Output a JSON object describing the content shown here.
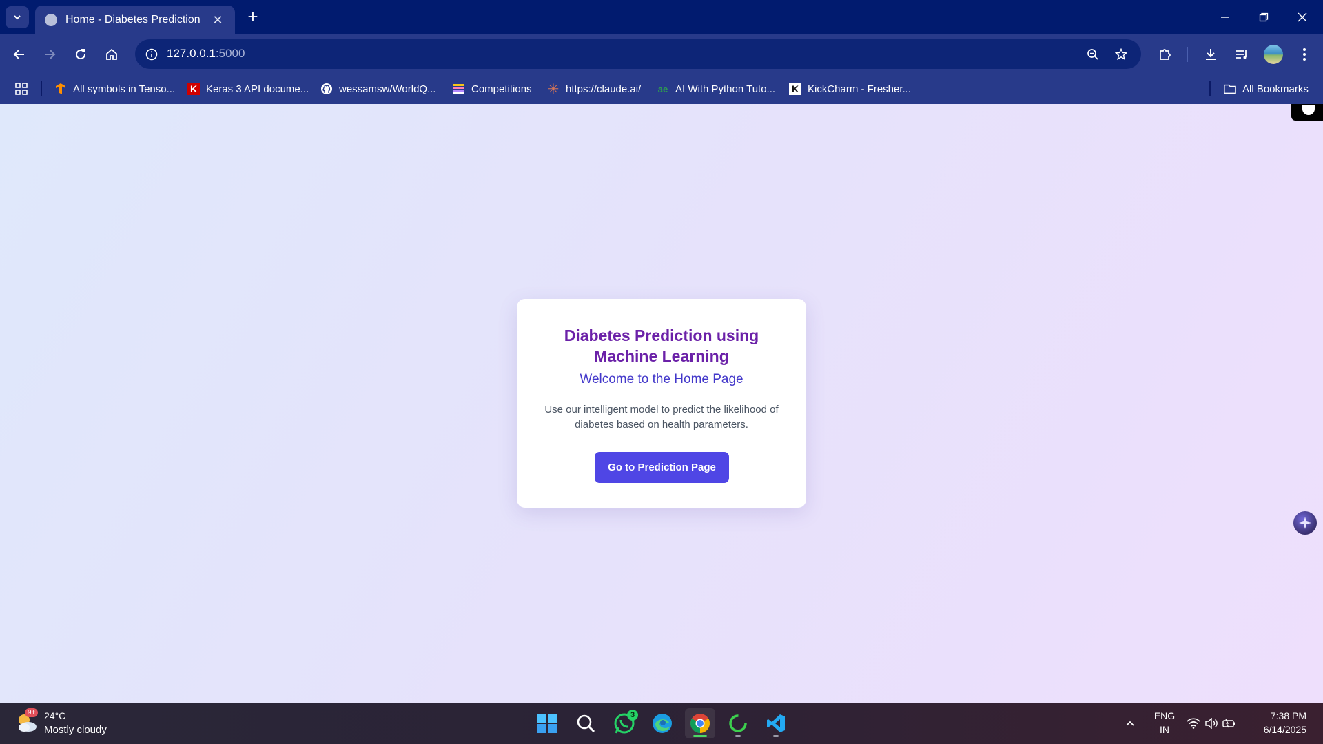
{
  "browser": {
    "tab_title": "Home - Diabetes Prediction",
    "new_tab_label": "+",
    "url_host": "127.0.0.1",
    "url_port": ":5000"
  },
  "bookmarks": [
    {
      "label": "All symbols in Tenso...",
      "icon": "tensorflow-icon"
    },
    {
      "label": "Keras 3 API docume...",
      "icon": "keras-icon"
    },
    {
      "label": "wessamsw/WorldQ...",
      "icon": "github-icon"
    },
    {
      "label": "Competitions",
      "icon": "competitions-icon"
    },
    {
      "label": "https://claude.ai/",
      "icon": "claude-icon"
    },
    {
      "label": "AI With Python Tuto...",
      "icon": "tutorial-icon"
    },
    {
      "label": "KickCharm - Fresher...",
      "icon": "kickcharm-icon"
    }
  ],
  "all_bookmarks_label": "All Bookmarks",
  "card": {
    "title": "Diabetes Prediction using Machine Learning",
    "subtitle": "Welcome to the Home Page",
    "description": "Use our intelligent model to predict the likelihood of diabetes based on health parameters.",
    "button_label": "Go to Prediction Page"
  },
  "taskbar": {
    "weather_temp": "24°C",
    "weather_desc": "Mostly cloudy",
    "weather_badge": "9+",
    "whatsapp_badge": "3",
    "language_line1": "ENG",
    "language_line2": "IN",
    "time": "7:38 PM",
    "date": "6/14/2025"
  },
  "colors": {
    "title": "#6b21a8",
    "subtitle": "#4338ca",
    "button": "#4f46e5",
    "browser_frame": "#011b6f"
  }
}
